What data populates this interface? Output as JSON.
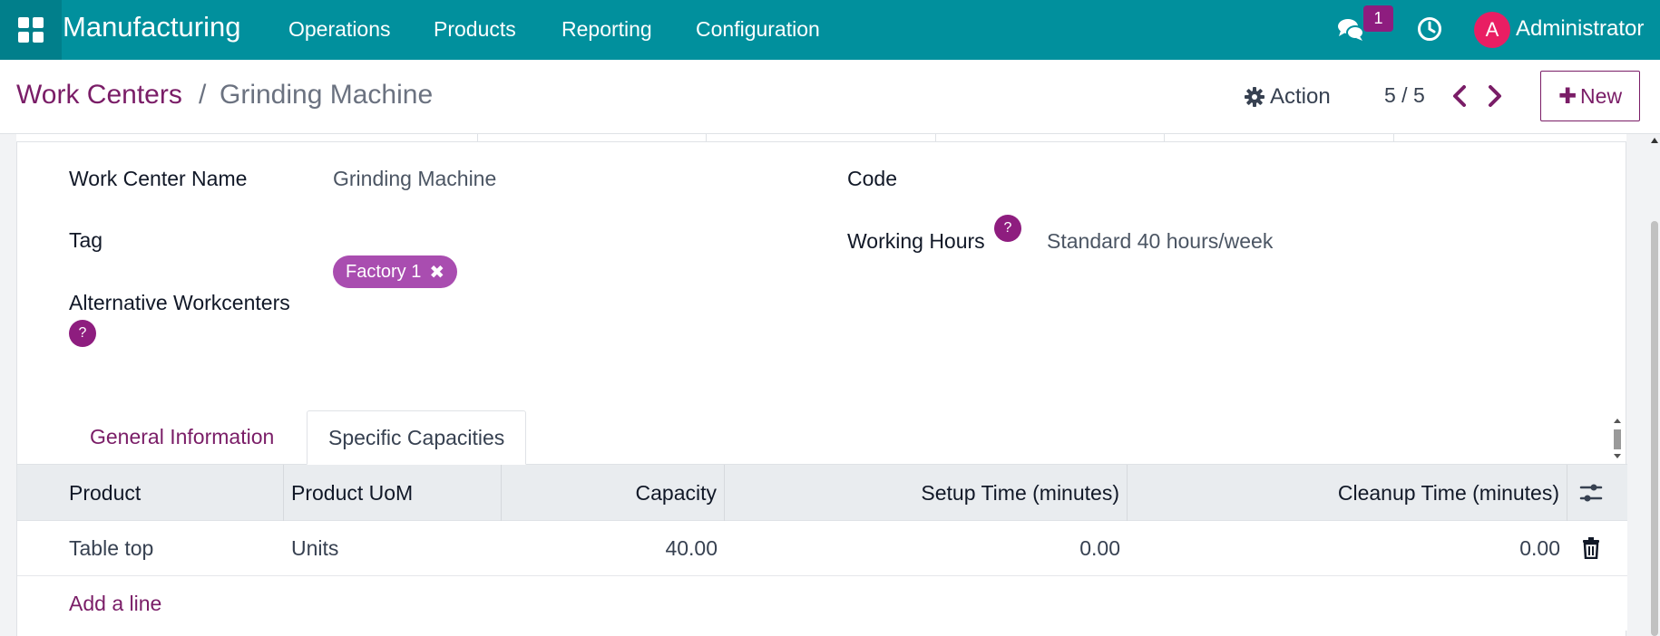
{
  "navbar": {
    "app_name": "Manufacturing",
    "menu": [
      "Operations",
      "Products",
      "Reporting",
      "Configuration"
    ],
    "chat_badge": "1",
    "avatar_letter": "A",
    "user_name": "Administrator",
    "bg_color": "#01909d",
    "badge_color": "#8e1d7f",
    "avatar_color": "#e91e63"
  },
  "control_panel": {
    "breadcrumb_parent": "Work Centers",
    "breadcrumb_separator": "/",
    "breadcrumb_current": "Grinding Machine",
    "action_label": "Action",
    "pager": "5 / 5",
    "new_label": "New"
  },
  "form": {
    "name_label": "Work Center Name",
    "name_value": "Grinding Machine",
    "code_label": "Code",
    "code_value": "",
    "tag_label": "Tag",
    "tag_value": "Factory 1",
    "working_hours_label": "Working Hours",
    "working_hours_value": "Standard 40 hours/week",
    "alt_label": "Alternative Workcenters",
    "help_mark": "?"
  },
  "tabs": {
    "general": "General Information",
    "capacities": "Specific Capacities",
    "active": "Specific Capacities"
  },
  "table": {
    "headers": [
      "Product",
      "Product UoM",
      "Capacity",
      "Setup Time (minutes)",
      "Cleanup Time (minutes)"
    ],
    "rows": [
      {
        "product": "Table top",
        "uom": "Units",
        "capacity": "40.00",
        "setup": "0.00",
        "cleanup": "0.00"
      }
    ],
    "add_line": "Add a line"
  },
  "accent_color": "#7a1d67"
}
